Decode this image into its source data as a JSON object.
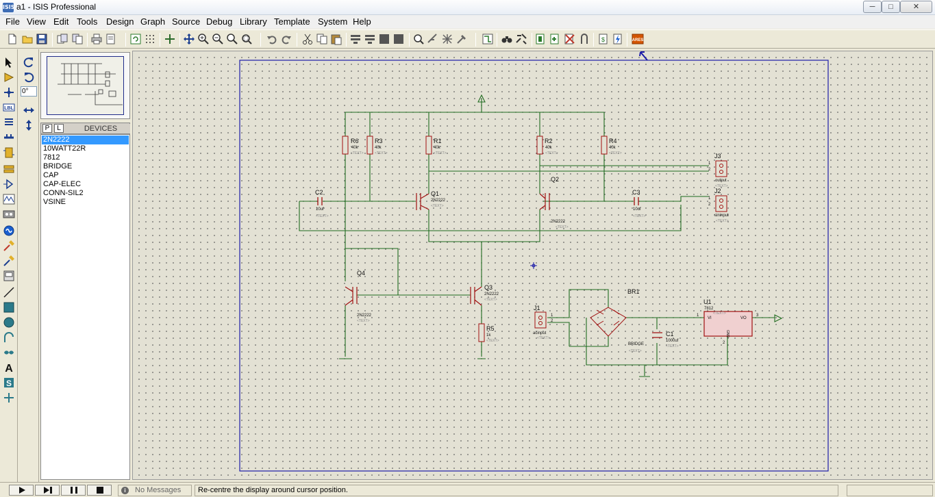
{
  "window": {
    "title": "a1 - ISIS Professional",
    "icon_label": "ISIS",
    "min": "─",
    "max": "□",
    "close": "✕"
  },
  "menu": [
    "File",
    "View",
    "Edit",
    "Tools",
    "Design",
    "Graph",
    "Source",
    "Debug",
    "Library",
    "Template",
    "System",
    "Help"
  ],
  "rotation": {
    "angle": "0°"
  },
  "devices_panel": {
    "pick_button": "P",
    "library_button": "L",
    "title": "DEVICES",
    "items": [
      "2N2222",
      "10WATT22R",
      "7812",
      "BRIDGE",
      "CAP",
      "CAP-ELEC",
      "CONN-SIL2",
      "VSINE"
    ],
    "selected_index": 0
  },
  "schematic": {
    "text_placeholder": "<TEXT>",
    "resistors": [
      {
        "ref": "R6",
        "value": "40k"
      },
      {
        "ref": "R3",
        "value": "40k"
      },
      {
        "ref": "R1",
        "value": "40k"
      },
      {
        "ref": "R2",
        "value": "40k"
      },
      {
        "ref": "R4",
        "value": "40k"
      },
      {
        "ref": "R5",
        "value": "1k"
      }
    ],
    "capacitors": [
      {
        "ref": "C2",
        "value": "10uf"
      },
      {
        "ref": "C3",
        "value": "10uf"
      },
      {
        "ref": "C1",
        "value": "1000uf"
      }
    ],
    "transistors": [
      {
        "ref": "Q1",
        "value": "2N2222"
      },
      {
        "ref": "Q2",
        "value": "2N2222"
      },
      {
        "ref": "Q3",
        "value": "2N2222"
      },
      {
        "ref": "Q4",
        "value": "2N2222"
      }
    ],
    "connectors": [
      {
        "ref": "J3",
        "name": "output",
        "pin1": "1",
        "pin2": "2"
      },
      {
        "ref": "J2",
        "name": "sininput",
        "pin1": "1",
        "pin2": "2"
      },
      {
        "ref": "J1",
        "name": "acinput",
        "pin1": "1",
        "pin2": "2"
      }
    ],
    "bridge": {
      "ref": "BR1",
      "value": "BRIDGE"
    },
    "regulator": {
      "ref": "U1",
      "value": "7812",
      "vi": "VI",
      "vo": "VO",
      "gnd": "GND",
      "pin1": "1",
      "pin2": "2",
      "pin3": "3"
    }
  },
  "status": {
    "messages": "No Messages",
    "hint": "Re-centre the display around cursor position."
  },
  "colors": {
    "canvas": "#e3e1d4",
    "wire": "#1f6b1f",
    "component": "#a01010",
    "sheet_border": "#1c1ca8",
    "selected_item": "#3399ff"
  }
}
